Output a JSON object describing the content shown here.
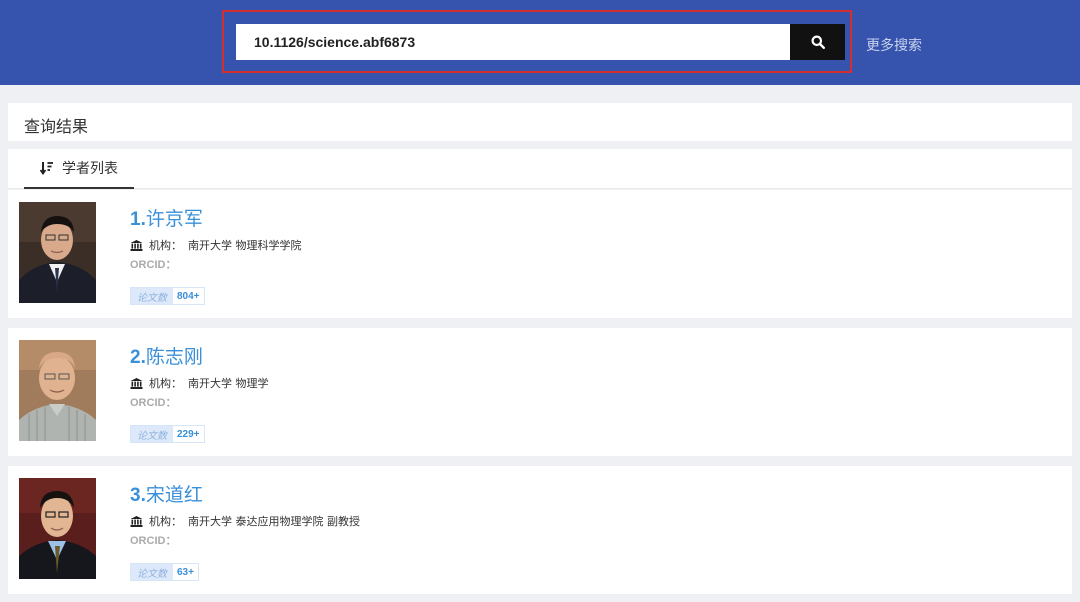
{
  "search": {
    "value": "10.1126/science.abf6873",
    "more_search_label": "更多搜索"
  },
  "results": {
    "title": "查询结果",
    "tab_label": "学者列表"
  },
  "scholars": [
    {
      "index": "1.",
      "name": "许京军",
      "institution_label": "机构：",
      "institution": "南开大学 物理科学学院",
      "orcid_label": "ORCID：",
      "papers_label": "论文数",
      "papers_count": "804+"
    },
    {
      "index": "2.",
      "name": "陈志刚",
      "institution_label": "机构：",
      "institution": "南开大学 物理学",
      "orcid_label": "ORCID：",
      "papers_label": "论文数",
      "papers_count": "229+"
    },
    {
      "index": "3.",
      "name": "宋道红",
      "institution_label": "机构：",
      "institution": "南开大学 泰达应用物理学院 副教授",
      "orcid_label": "ORCID：",
      "papers_label": "论文数",
      "papers_count": "63+"
    }
  ],
  "colors": {
    "header_bg": "#3654ad",
    "highlight_border": "#d32f2f",
    "link_blue": "#3a8fd9"
  },
  "icons": {
    "search": "search-icon",
    "sort": "sort-icon",
    "institution": "institution-icon"
  }
}
